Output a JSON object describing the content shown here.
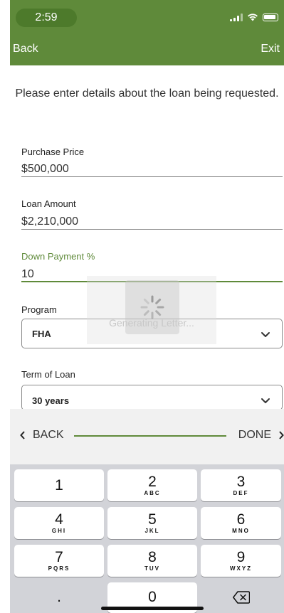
{
  "status_bar": {
    "time": "2:59"
  },
  "nav": {
    "back_label": "Back",
    "exit_label": "Exit"
  },
  "intro_text": "Please enter details about the loan being requested.",
  "form": {
    "purchase_price": {
      "label": "Purchase Price",
      "value": "$500,000"
    },
    "loan_amount": {
      "label": "Loan Amount",
      "value": "$2,210,000"
    },
    "down_payment": {
      "label": "Down Payment %",
      "value": "10"
    },
    "program": {
      "label": "Program",
      "value": "FHA"
    },
    "term": {
      "label": "Term of Loan",
      "value": "30 years"
    }
  },
  "loading": {
    "message": "Generating Letter..."
  },
  "accessory": {
    "back_label": "BACK",
    "done_label": "DONE"
  },
  "keyboard": {
    "keys": [
      {
        "num": "1",
        "letters": ""
      },
      {
        "num": "2",
        "letters": "ABC"
      },
      {
        "num": "3",
        "letters": "DEF"
      },
      {
        "num": "4",
        "letters": "GHI"
      },
      {
        "num": "5",
        "letters": "JKL"
      },
      {
        "num": "6",
        "letters": "MNO"
      },
      {
        "num": "7",
        "letters": "PQRS"
      },
      {
        "num": "8",
        "letters": "TUV"
      },
      {
        "num": "9",
        "letters": "WXYZ"
      },
      {
        "num": ".",
        "letters": ""
      },
      {
        "num": "0",
        "letters": ""
      }
    ]
  },
  "colors": {
    "brand": "#5f8a3a",
    "keyboard_bg": "#d2d3d8"
  },
  "icons": [
    "signal-icon",
    "wifi-icon",
    "battery-icon",
    "chevron-down-icon",
    "spinner-icon",
    "chevron-left-icon",
    "chevron-right-icon",
    "backspace-icon"
  ]
}
